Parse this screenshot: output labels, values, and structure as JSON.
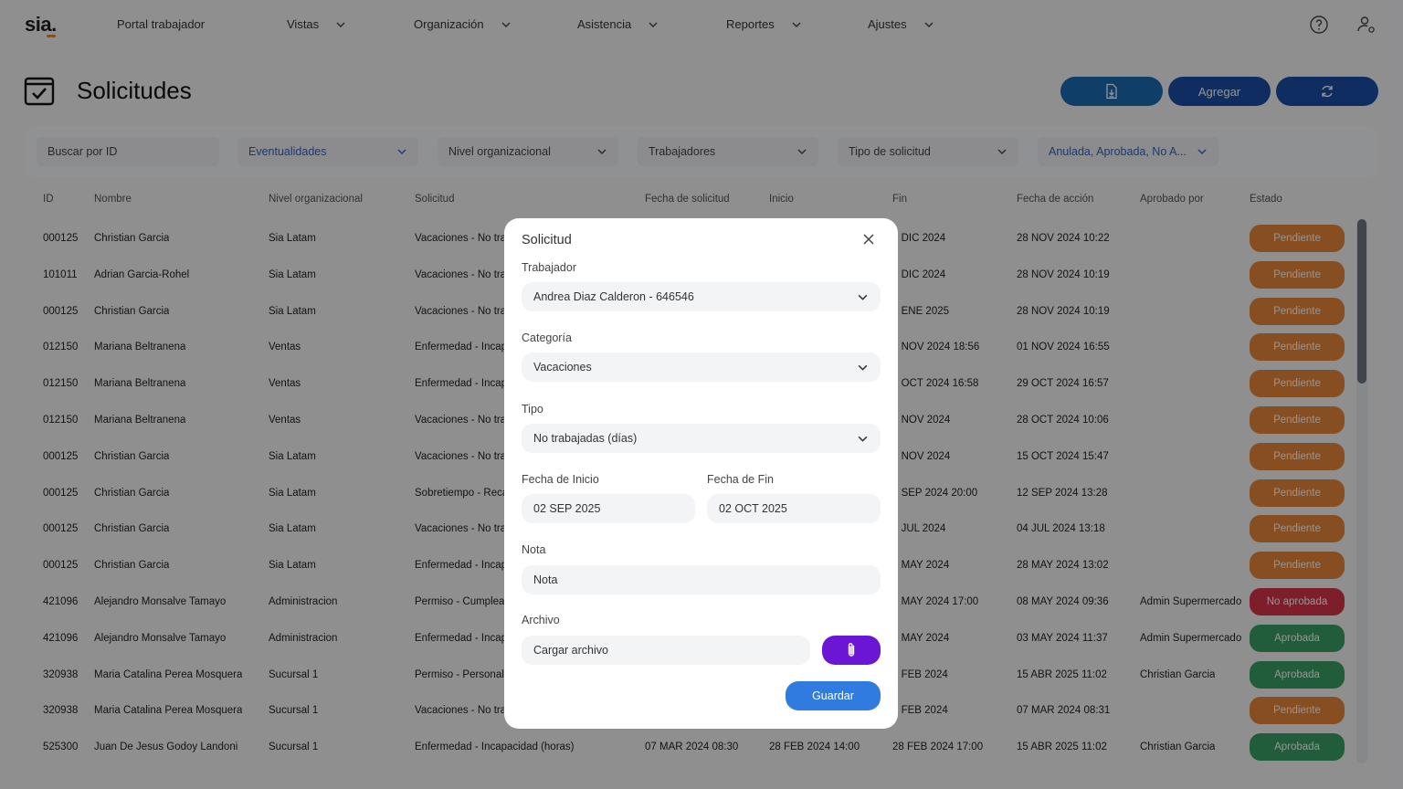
{
  "app": {
    "logo": "sia."
  },
  "nav": {
    "items": [
      {
        "label": "Portal trabajador",
        "has_caret": false
      },
      {
        "label": "Vistas",
        "has_caret": true
      },
      {
        "label": "Organización",
        "has_caret": true
      },
      {
        "label": "Asistencia",
        "has_caret": true
      },
      {
        "label": "Reportes",
        "has_caret": true
      },
      {
        "label": "Ajustes",
        "has_caret": true
      }
    ],
    "help_icon": "help-circle-icon",
    "user_icon": "user-settings-icon"
  },
  "header": {
    "title": "Solicitudes",
    "export_icon": "file-download-icon",
    "add_label": "Agregar",
    "refresh_icon": "refresh-icon",
    "colors": {
      "export": "#1a6bb5",
      "add": "#1a4fa8",
      "refresh": "#1a4fa8"
    }
  },
  "filters": {
    "search_placeholder": "Buscar por ID",
    "items": [
      "Eventualidades",
      "Nivel organizacional",
      "Trabajadores",
      "Tipo de solicitud",
      "Anulada, Aprobada, No A..."
    ]
  },
  "table": {
    "columns": [
      "ID",
      "Nombre",
      "Nivel organizacional",
      "Solicitud",
      "Fecha de solicitud",
      "Inicio",
      "Fin",
      "Fecha de acción",
      "Aprobado por",
      "Estado"
    ],
    "rows": [
      {
        "id": "000125",
        "nombre": "Christian Garcia",
        "nivel": "Sia Latam",
        "solicitud": "Vacaciones - No tra",
        "fecha_sol": "",
        "inicio": "",
        "fin": "5 DIC 2024",
        "accion": "28 NOV 2024 10:22",
        "aprobado": "",
        "estado": "Pendiente"
      },
      {
        "id": "101011",
        "nombre": "Adrian Garcia-Rohel",
        "nivel": "Sia Latam",
        "solicitud": "Vacaciones - No tra",
        "fecha_sol": "",
        "inicio": "",
        "fin": "1 DIC 2024",
        "accion": "28 NOV 2024 10:19",
        "aprobado": "",
        "estado": "Pendiente"
      },
      {
        "id": "000125",
        "nombre": "Christian Garcia",
        "nivel": "Sia Latam",
        "solicitud": "Vacaciones - No tra",
        "fecha_sol": "",
        "inicio": "",
        "fin": "1 ENE 2025",
        "accion": "28 NOV 2024 10:19",
        "aprobado": "",
        "estado": "Pendiente"
      },
      {
        "id": "012150",
        "nombre": "Mariana Beltranena",
        "nivel": "Ventas",
        "solicitud": "Enfermedad - Incap",
        "fecha_sol": "",
        "inicio": "",
        "fin": "1 NOV 2024 18:56",
        "accion": "01 NOV 2024 16:55",
        "aprobado": "",
        "estado": "Pendiente"
      },
      {
        "id": "012150",
        "nombre": "Mariana Beltranena",
        "nivel": "Ventas",
        "solicitud": "Enfermedad - Incap",
        "fecha_sol": "",
        "inicio": "",
        "fin": "9 OCT 2024 16:58",
        "accion": "29 OCT 2024 16:57",
        "aprobado": "",
        "estado": "Pendiente"
      },
      {
        "id": "012150",
        "nombre": "Mariana Beltranena",
        "nivel": "Ventas",
        "solicitud": "Vacaciones - No tra",
        "fecha_sol": "",
        "inicio": "",
        "fin": "8 NOV 2024",
        "accion": "28 OCT 2024 10:06",
        "aprobado": "",
        "estado": "Pendiente"
      },
      {
        "id": "000125",
        "nombre": "Christian Garcia",
        "nivel": "Sia Latam",
        "solicitud": "Vacaciones - No tra",
        "fecha_sol": "",
        "inicio": "",
        "fin": "0 NOV 2024",
        "accion": "15 OCT 2024 15:47",
        "aprobado": "",
        "estado": "Pendiente"
      },
      {
        "id": "000125",
        "nombre": "Christian Garcia",
        "nivel": "Sia Latam",
        "solicitud": "Sobretiempo - Reca",
        "fecha_sol": "",
        "inicio": "",
        "fin": "2 SEP 2024 20:00",
        "accion": "12 SEP 2024 13:28",
        "aprobado": "",
        "estado": "Pendiente"
      },
      {
        "id": "000125",
        "nombre": "Christian Garcia",
        "nivel": "Sia Latam",
        "solicitud": "Vacaciones - No tra",
        "fecha_sol": "",
        "inicio": "",
        "fin": "9 JUL 2024",
        "accion": "04 JUL 2024 13:18",
        "aprobado": "",
        "estado": "Pendiente"
      },
      {
        "id": "000125",
        "nombre": "Christian Garcia",
        "nivel": "Sia Latam",
        "solicitud": "Enfermedad - Incap",
        "fecha_sol": "",
        "inicio": "",
        "fin": "0 MAY 2024",
        "accion": "28 MAY 2024 13:02",
        "aprobado": "",
        "estado": "Pendiente"
      },
      {
        "id": "421096",
        "nombre": "Alejandro Monsalve Tamayo",
        "nivel": "Administracion",
        "solicitud": "Permiso - Cumpleaí",
        "fecha_sol": "",
        "inicio": "",
        "fin": "9 MAY 2024 17:00",
        "accion": "08 MAY 2024 09:36",
        "aprobado": "Admin Supermercado",
        "estado": "No aprobada"
      },
      {
        "id": "421096",
        "nombre": "Alejandro Monsalve Tamayo",
        "nivel": "Administracion",
        "solicitud": "Enfermedad - Incap",
        "fecha_sol": "",
        "inicio": "",
        "fin": "3 MAY 2024",
        "accion": "03 MAY 2024 11:37",
        "aprobado": "Admin Supermercado",
        "estado": "Aprobada"
      },
      {
        "id": "320938",
        "nombre": "Maria Catalina Perea Mosquera",
        "nivel": "Sucursal 1",
        "solicitud": "Permiso - Personal (",
        "fecha_sol": "",
        "inicio": "",
        "fin": "5 FEB 2024",
        "accion": "15 ABR 2025 11:02",
        "aprobado": "Christian Garcia",
        "estado": "Aprobada"
      },
      {
        "id": "320938",
        "nombre": "Maria Catalina Perea Mosquera",
        "nivel": "Sucursal 1",
        "solicitud": "Vacaciones - No tra",
        "fecha_sol": "",
        "inicio": "",
        "fin": "7 FEB 2024",
        "accion": "07 MAR 2024 08:31",
        "aprobado": "",
        "estado": "Pendiente"
      },
      {
        "id": "525300",
        "nombre": "Juan De Jesus Godoy Landoni",
        "nivel": "Sucursal 1",
        "solicitud": "Enfermedad - Incapacidad (horas)",
        "fecha_sol": "07 MAR 2024 08:30",
        "inicio": "28 FEB 2024 14:00",
        "fin": "28 FEB 2024 17:00",
        "accion": "15 ABR 2025 11:02",
        "aprobado": "Christian Garcia",
        "estado": "Aprobada"
      }
    ],
    "status_colors": {
      "Pendiente": "#e8893a",
      "No aprobada": "#d9354a",
      "Aprobada": "#3aa064"
    }
  },
  "modal": {
    "title": "Solicitud",
    "close_icon": "close-icon",
    "trabajador_label": "Trabajador",
    "trabajador_value": "Andrea Diaz Calderon - 646546",
    "categoria_label": "Categoría",
    "categoria_value": "Vacaciones",
    "tipo_label": "Tipo",
    "tipo_value": "No trabajadas (días)",
    "fecha_inicio_label": "Fecha de Inicio",
    "fecha_inicio_value": "02 SEP 2025",
    "fecha_fin_label": "Fecha de Fin",
    "fecha_fin_value": "02 OCT 2025",
    "nota_label": "Nota",
    "nota_placeholder": "Nota",
    "archivo_label": "Archivo",
    "archivo_placeholder": "Cargar archivo",
    "attach_icon": "paperclip-icon",
    "save_label": "Guardar",
    "colors": {
      "attach": "#6a16d4",
      "save": "#2f7be0"
    }
  }
}
